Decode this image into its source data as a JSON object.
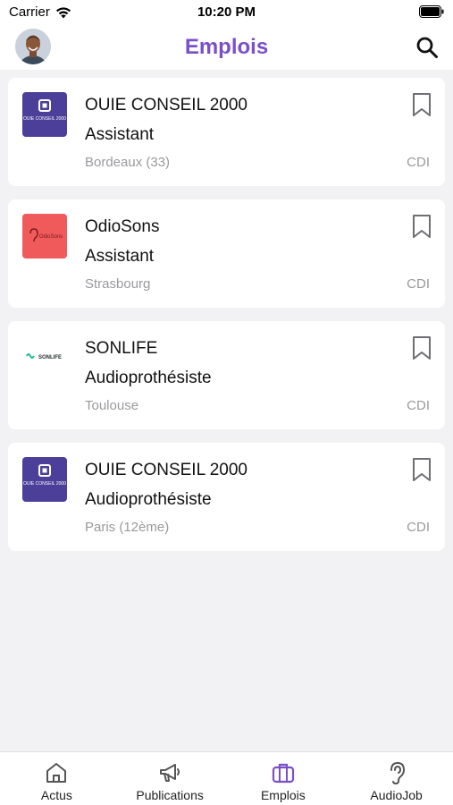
{
  "status_bar": {
    "carrier": "Carrier",
    "time": "10:20 PM"
  },
  "header": {
    "title": "Emplois"
  },
  "jobs": [
    {
      "company": "OUIE CONSEIL 2000",
      "title": "Assistant",
      "location": "Bordeaux (33)",
      "contract": "CDI",
      "logo_text": "OUIE CONSEIL 2000"
    },
    {
      "company": "OdioSons",
      "title": "Assistant",
      "location": "Strasbourg",
      "contract": "CDI",
      "logo_text": "OdioSons"
    },
    {
      "company": "SONLIFE",
      "title": "Audioprothésiste",
      "location": "Toulouse",
      "contract": "CDI",
      "logo_text": "SONLIFE"
    },
    {
      "company": "OUIE CONSEIL 2000",
      "title": "Audioprothésiste",
      "location": "Paris (12ème)",
      "contract": "CDI",
      "logo_text": "OUIE CONSEIL 2000"
    }
  ],
  "tabs": [
    {
      "label": "Actus",
      "icon": "home-icon"
    },
    {
      "label": "Publications",
      "icon": "megaphone-icon"
    },
    {
      "label": "Emplois",
      "icon": "briefcase-icon",
      "active": true
    },
    {
      "label": "AudioJob",
      "icon": "ear-icon"
    }
  ],
  "colors": {
    "accent": "#7a4fc9",
    "ouie_logo": "#4b3f9a",
    "odio_logo": "#f05a5a",
    "sonlife_logo": "#2bb99a"
  }
}
